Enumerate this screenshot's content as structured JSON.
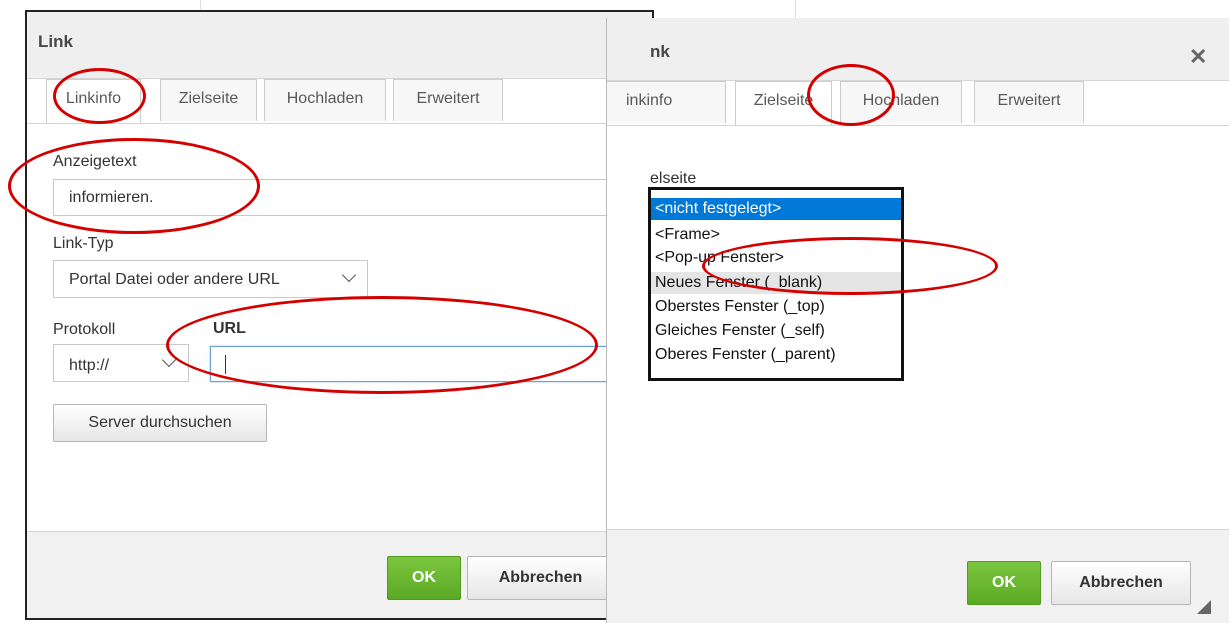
{
  "left_dialog": {
    "title": "Link",
    "close_glyph": "✕",
    "tabs": [
      "Linkinfo",
      "Zielseite",
      "Hochladen",
      "Erweitert"
    ],
    "active_tab": "Linkinfo",
    "display_text_label": "Anzeigetext",
    "display_text_value": "informieren.",
    "link_type_label": "Link-Typ",
    "link_type_value": "Portal Datei oder andere URL",
    "protocol_label": "Protokoll",
    "protocol_value": "http://",
    "url_label": "URL",
    "url_value": "",
    "browse_button": "Server durchsuchen",
    "ok_button": "OK",
    "cancel_button": "Abbrechen"
  },
  "right_dialog": {
    "title": "nk",
    "close_glyph": "✕",
    "tabs": [
      "inkinfo",
      "Zielseite",
      "Hochladen",
      "Erweitert"
    ],
    "active_tab": "Zielseite",
    "target_label": "elseite",
    "target_options": [
      "<nicht festgelegt>",
      "<Frame>",
      "<Pop-up Fenster>",
      "Neues Fenster (_blank)",
      "Oberstes Fenster (_top)",
      "Gleiches Fenster (_self)",
      "Oberes Fenster (_parent)"
    ],
    "target_options_display": [
      "<nicht festgelegt>",
      "<Frame>",
      "<Pop-up Fenster>",
      "Neues Fenster (_blank)",
      "Oberstes Fenster (_top)",
      "Gleiches Fenster (_self)",
      "Oberes Fenster (_parent)"
    ],
    "selected_option": "<nicht festgelegt>",
    "hovered_option": "Neues Fenster (_blank)",
    "ok_button": "OK",
    "cancel_button": "Abbrechen"
  },
  "annotation_color": "#d40000",
  "ok_color": "#5aa924",
  "selection_color": "#0078d7"
}
